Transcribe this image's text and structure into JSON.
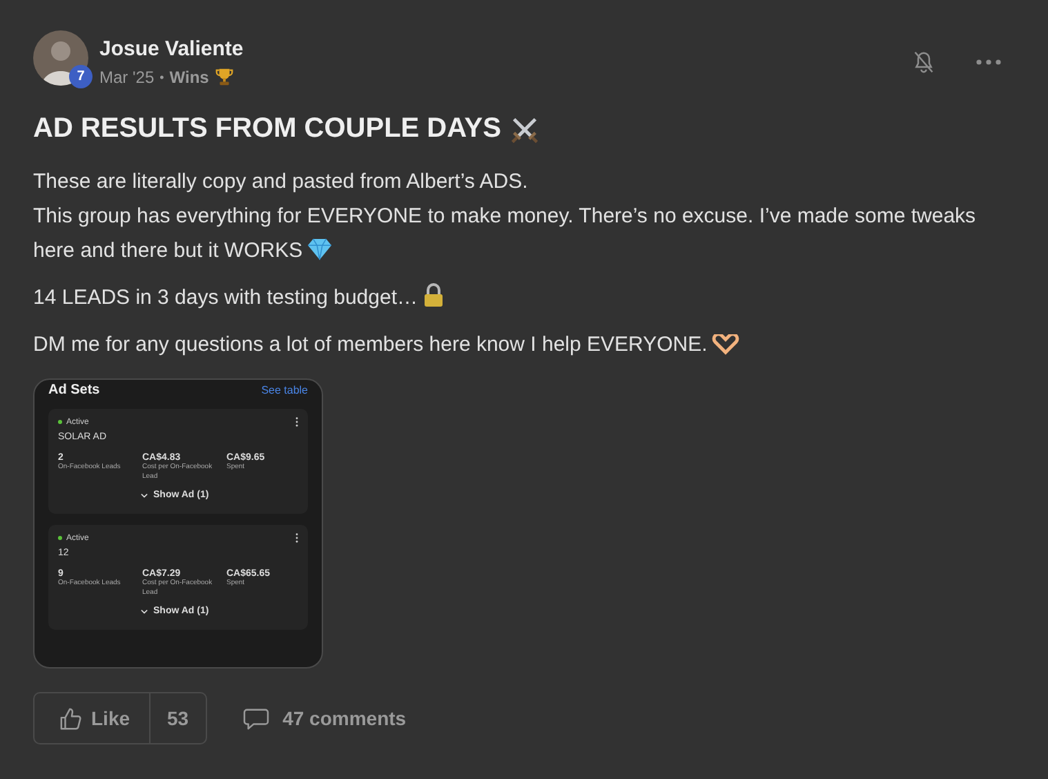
{
  "author": {
    "name": "Josue Valiente",
    "level": "7"
  },
  "meta": {
    "date": "Mar '25",
    "separator": "•",
    "category": "Wins"
  },
  "title": "AD RESULTS FROM COUPLE DAYS",
  "body": [
    {
      "lines": [
        "These are literally copy and pasted from Albert’s ADS.",
        "This group has everything for EVERYONE to make money. There’s no excuse. I’ve made some tweaks",
        "here and there but it WORKS"
      ],
      "kind": "gem"
    },
    {
      "lines": [
        "14 LEADS in 3 days with testing budget…"
      ],
      "kind": "lock"
    },
    {
      "lines": [
        "DM me for any questions a lot of members here know I help EVERYONE."
      ],
      "kind": "hands"
    }
  ],
  "screenshot": {
    "title": "Ad Sets",
    "link": "See table",
    "ad_sets": [
      {
        "status": "Active",
        "name": "SOLAR AD",
        "metrics": [
          {
            "value": "2",
            "label": "On-Facebook Leads"
          },
          {
            "value": "CA$4.83",
            "label": "Cost per On-Facebook Lead"
          },
          {
            "value": "CA$9.65",
            "label": "Spent"
          }
        ],
        "toggle": "Show Ad (1)"
      },
      {
        "status": "Active",
        "name": "12",
        "metrics": [
          {
            "value": "9",
            "label": "On-Facebook Leads"
          },
          {
            "value": "CA$7.29",
            "label": "Cost per On-Facebook Lead"
          },
          {
            "value": "CA$65.65",
            "label": "Spent"
          }
        ],
        "toggle": "Show Ad (1)"
      }
    ]
  },
  "actions": {
    "like_label": "Like",
    "like_count": "53",
    "comments": "47 comments"
  }
}
